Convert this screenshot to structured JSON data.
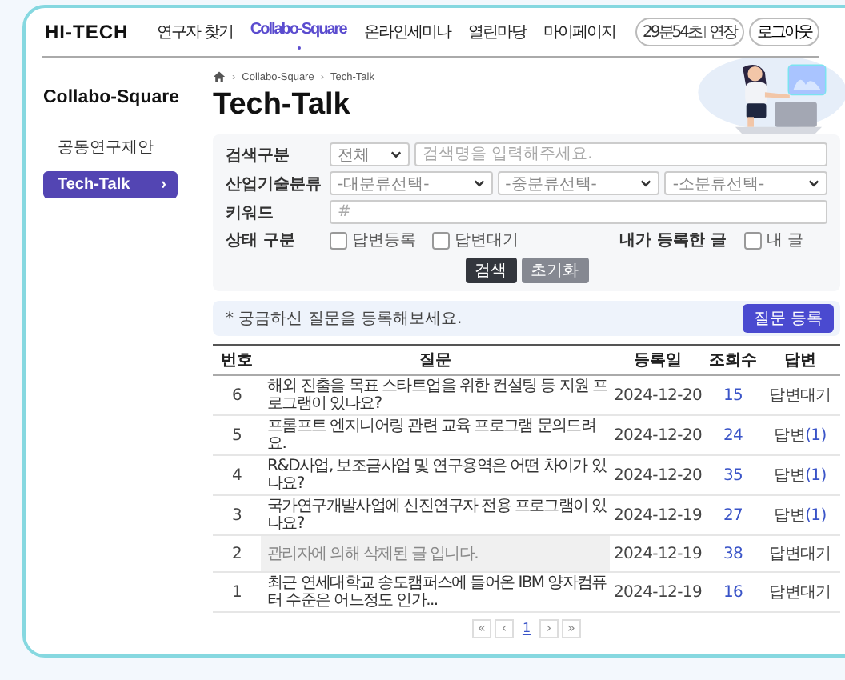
{
  "header": {
    "logo": "HI-TECH",
    "nav": [
      {
        "label": "연구자 찾기",
        "selected": false
      },
      {
        "label": "Collabo-Square",
        "selected": true
      },
      {
        "label": "온라인세미나",
        "selected": false
      },
      {
        "label": "열린마당",
        "selected": false
      },
      {
        "label": "마이페이지",
        "selected": false
      }
    ],
    "session_timer": "29분54초",
    "extend": "연장",
    "logout": "로그아웃"
  },
  "sidebar": {
    "title": "Collabo-Square",
    "items": [
      {
        "label": "공동연구제안",
        "selected": false
      },
      {
        "label": "Tech-Talk",
        "selected": true,
        "chevron": "›"
      }
    ]
  },
  "breadcrumb": [
    {
      "separator": "›",
      "label": "Collabo-Square"
    },
    {
      "separator": "›",
      "label": "Tech-Talk"
    }
  ],
  "page_title": "Tech-Talk",
  "filter": {
    "search_type": {
      "label": "검색구분",
      "value": "전체",
      "placeholder": "검색명을 입력해주세요."
    },
    "category": {
      "label": "산업기술분류",
      "selects": [
        "-대분류선택-",
        "-중분류선택-",
        "-소분류선택-"
      ]
    },
    "keyword": {
      "label": "키워드",
      "placeholder": "#"
    },
    "status": {
      "label": "상태 구분",
      "options": [
        {
          "label": "답변등록",
          "checked": false
        },
        {
          "label": "답변대기",
          "checked": false
        }
      ]
    },
    "mine": {
      "label": "내가 등록한 글",
      "options": [
        {
          "label": "내 글",
          "checked": false
        }
      ]
    },
    "buttons": [
      "검색",
      "초기화"
    ]
  },
  "notice": {
    "text": "* 궁금하신 질문을 등록해보세요.",
    "button": "질문 등록"
  },
  "table": {
    "columns": [
      "번호",
      "질문",
      "등록일",
      "조회수",
      "답변"
    ],
    "rows": [
      {
        "kind": "normal",
        "no": "6",
        "question": "해외 진출을 목표 스타트업을 위한 컨설팅 등 지원 프로그램이 있나요?",
        "date": "2024-12-20",
        "views": "15",
        "answer": {
          "kind": "waiting",
          "label": "답변대기"
        }
      },
      {
        "kind": "normal",
        "no": "5",
        "question": "프롬프트 엔지니어링 관련 교육 프로그램 문의드려요.",
        "date": "2024-12-20",
        "views": "24",
        "answer": {
          "kind": "answered",
          "label": "답변",
          "count": "(1)"
        }
      },
      {
        "kind": "normal",
        "no": "4",
        "question": "R&D사업, 보조금사업 및 연구용역은 어떤 차이가 있나요?",
        "date": "2024-12-20",
        "views": "35",
        "answer": {
          "kind": "answered",
          "label": "답변",
          "count": "(1)"
        }
      },
      {
        "kind": "normal",
        "no": "3",
        "question": "국가연구개발사업에 신진연구자 전용 프로그램이 있나요?",
        "date": "2024-12-19",
        "views": "27",
        "answer": {
          "kind": "answered",
          "label": "답변",
          "count": "(1)"
        }
      },
      {
        "kind": "deleted",
        "no": "2",
        "question": "관리자에 의해 삭제된 글 입니다.",
        "date": "2024-12-19",
        "views": "38",
        "answer": {
          "kind": "waiting",
          "label": "답변대기"
        }
      },
      {
        "kind": "normal",
        "no": "1",
        "question": "최근 연세대학교 송도캠퍼스에 들어온 IBM 양자컴퓨터 수준은 어느정도 인가...",
        "date": "2024-12-19",
        "views": "16",
        "answer": {
          "kind": "waiting",
          "label": "답변대기"
        }
      }
    ]
  },
  "pagination": [
    {
      "label": "«",
      "selected": false
    },
    {
      "label": "‹",
      "selected": false
    },
    {
      "label": "1",
      "selected": true
    },
    {
      "label": "›",
      "selected": false
    },
    {
      "label": "»",
      "selected": false
    }
  ]
}
